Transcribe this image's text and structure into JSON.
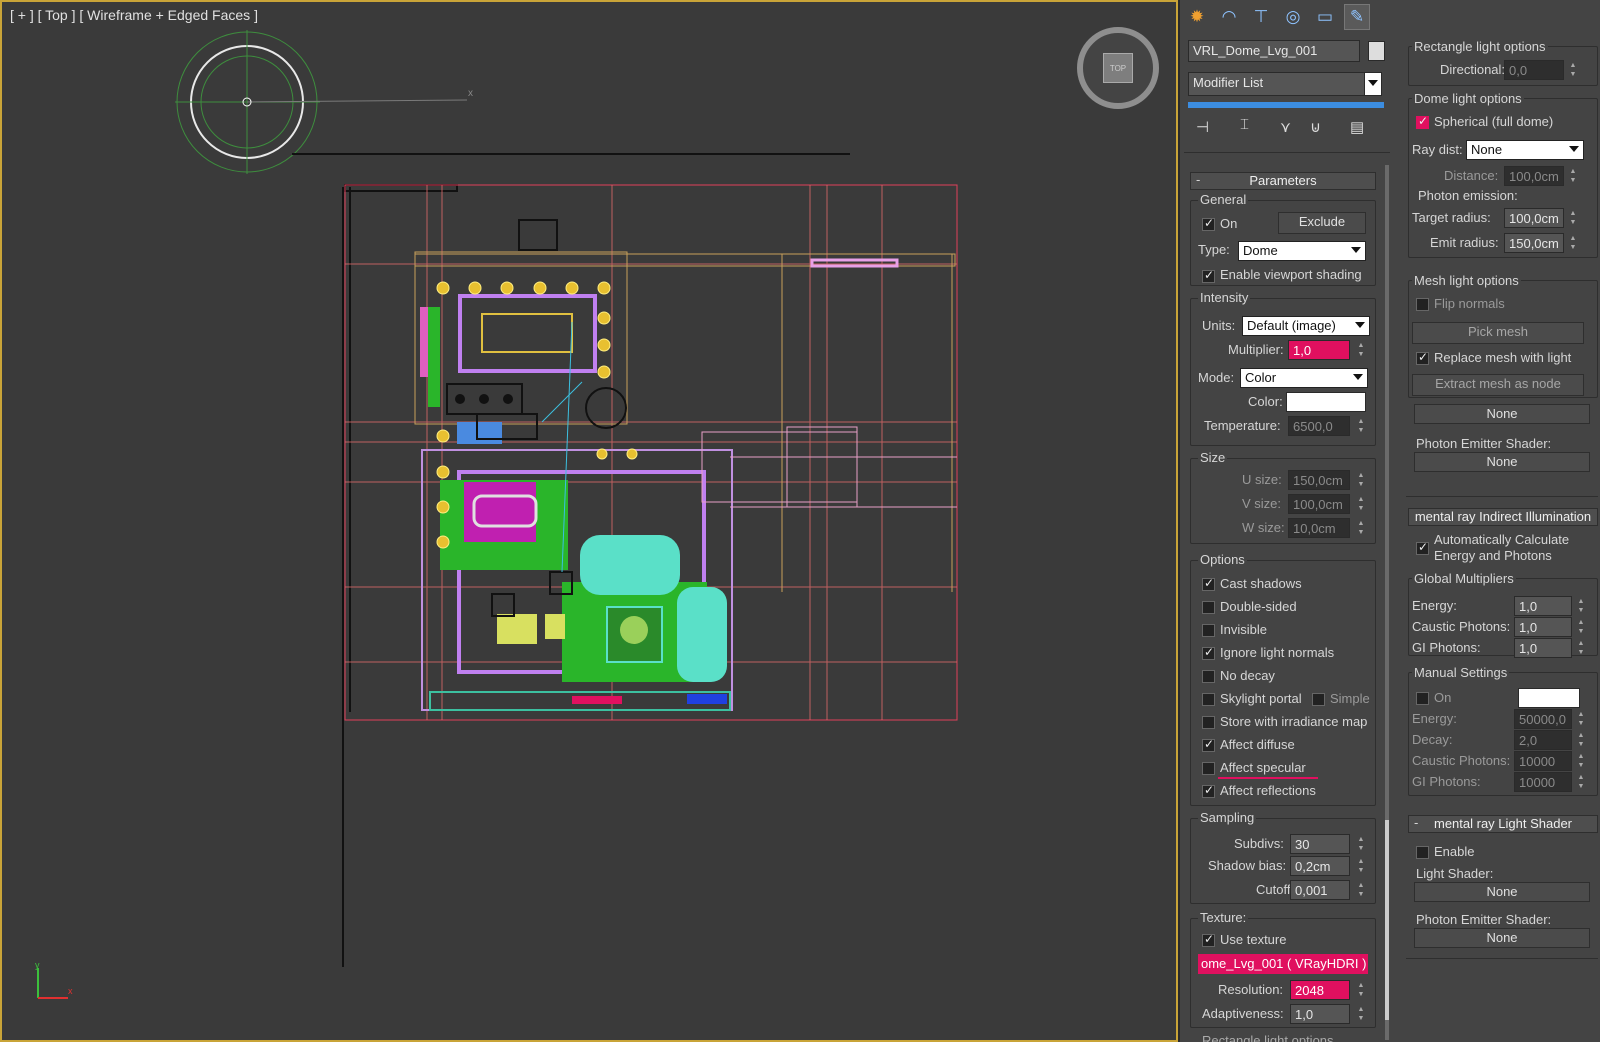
{
  "viewport": {
    "label": "[ + ] [ Top ] [ Wireframe + Edged Faces ]",
    "viewcube": "TOP"
  },
  "panel": {
    "tabs": [
      "create-icon",
      "modify-icon",
      "hierarchy-icon",
      "motion-icon",
      "display-icon",
      "utilities-icon"
    ],
    "object_name": "VRL_Dome_Lvg_001",
    "modifier_list": "Modifier List",
    "parameters": {
      "title": "Parameters",
      "general": "General",
      "on": "On",
      "exclude": "Exclude",
      "type_label": "Type:",
      "type_value": "Dome",
      "viewport_shading": "Enable viewport shading",
      "intensity": "Intensity",
      "units_label": "Units:",
      "units_value": "Default (image)",
      "multiplier_label": "Multiplier:",
      "multiplier_value": "1,0",
      "mode_label": "Mode:",
      "mode_value": "Color",
      "color_label": "Color:",
      "temperature_label": "Temperature:",
      "temperature_value": "6500,0",
      "size": "Size",
      "usize_label": "U size:",
      "usize_value": "150,0cm",
      "vsize_label": "V size:",
      "vsize_value": "100,0cm",
      "wsize_label": "W size:",
      "wsize_value": "10,0cm",
      "options": "Options",
      "opt": {
        "cast_shadows": "Cast shadows",
        "double_sided": "Double-sided",
        "invisible": "Invisible",
        "ignore_normals": "Ignore light normals",
        "no_decay": "No decay",
        "skylight_portal": "Skylight portal",
        "simple": "Simple",
        "store_irradiance": "Store with irradiance map",
        "affect_diffuse": "Affect diffuse",
        "affect_specular": "Affect specular",
        "affect_reflections": "Affect reflections"
      },
      "sampling": "Sampling",
      "subdivs_label": "Subdivs:",
      "subdivs_value": "30",
      "shadow_bias_label": "Shadow bias:",
      "shadow_bias_value": "0,2cm",
      "cutoff_label": "Cutoff:",
      "cutoff_value": "0,001",
      "texture": "Texture:",
      "use_texture": "Use texture",
      "texture_map": "ome_Lvg_001 ( VRayHDRI )",
      "resolution_label": "Resolution:",
      "resolution_value": "2048",
      "adaptiveness_label": "Adaptiveness:",
      "adaptiveness_value": "1,0",
      "rect_options_footer": "Rectangle light options"
    },
    "right": {
      "rect_options": "Rectangle light options",
      "directional_label": "Directional:",
      "directional_value": "0,0",
      "dome_options": "Dome light options",
      "spherical": "Spherical (full dome)",
      "raydist_label": "Ray dist:",
      "raydist_value": "None",
      "distance_label": "Distance:",
      "distance_value": "100,0cm",
      "photon_emission": "Photon emission:",
      "target_radius_label": "Target radius:",
      "target_radius_value": "100,0cm",
      "emit_radius_label": "Emit radius:",
      "emit_radius_value": "150,0cm",
      "mesh_options": "Mesh light options",
      "flip_normals": "Flip normals",
      "pick_mesh": "Pick mesh",
      "replace_mesh": "Replace mesh with light",
      "extract_mesh": "Extract mesh as node",
      "none1": "None",
      "photon_shader_label": "Photon Emitter Shader:",
      "none2": "None",
      "mr_indirect": "mental ray Indirect Illumination",
      "auto_calc": "Automatically Calculate Energy and Photons",
      "global_mult": "Global Multipliers",
      "energy_label": "Energy:",
      "energy_value": "1,0",
      "caustic_label": "Caustic Photons:",
      "caustic_value": "1,0",
      "gi_label": "GI Photons:",
      "gi_value": "1,0",
      "manual": "Manual Settings",
      "on": "On",
      "m_energy_label": "Energy:",
      "m_energy_value": "50000,0",
      "m_decay_label": "Decay:",
      "m_decay_value": "2,0",
      "m_caustic_label": "Caustic Photons:",
      "m_caustic_value": "10000",
      "m_gi_label": "GI Photons:",
      "m_gi_value": "10000",
      "mr_light_shader": "mental ray Light Shader",
      "enable": "Enable",
      "light_shader_label": "Light Shader:",
      "none3": "None",
      "photon_shader2_label": "Photon Emitter Shader:",
      "none4": "None"
    }
  },
  "colors": {
    "accent_pink": "#e0105f",
    "viewport_border": "#c9a438",
    "selection_blue": "#3c8de0"
  }
}
